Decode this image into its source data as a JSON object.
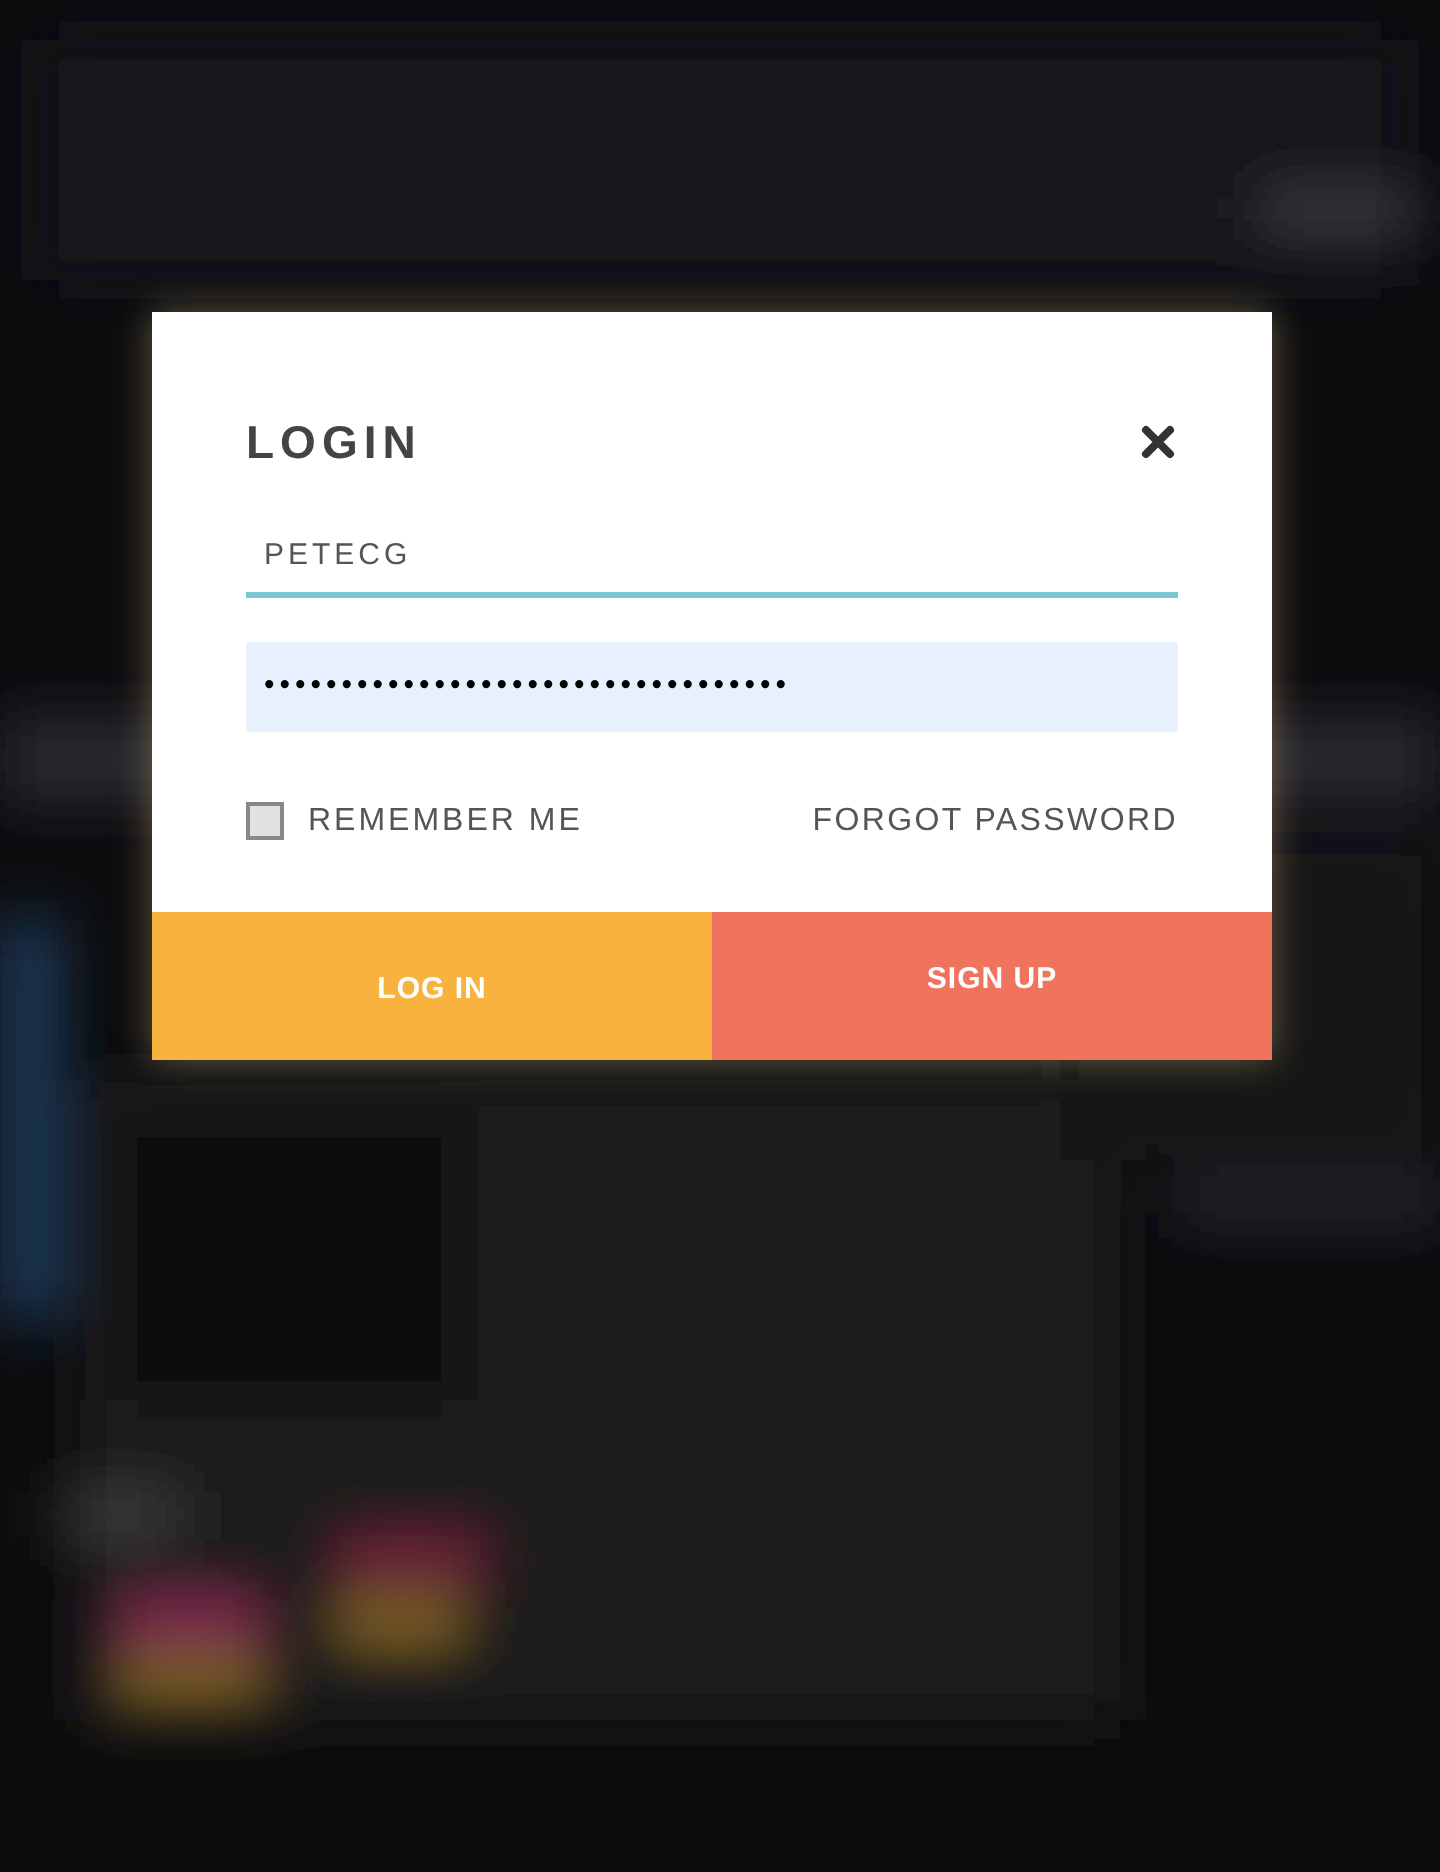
{
  "dialog": {
    "title": "LOGIN",
    "username": {
      "value": "PETECG",
      "focused": true
    },
    "password": {
      "value": "••••••••••••••••••••••••••••••••••"
    },
    "remember_me": {
      "label": "REMEMBER ME",
      "checked": false
    },
    "forgot_password": "FORGOT PASSWORD",
    "buttons": [
      {
        "label": "LOG IN",
        "kind": "login"
      },
      {
        "label": "SIGN UP",
        "kind": "signup"
      }
    ]
  }
}
